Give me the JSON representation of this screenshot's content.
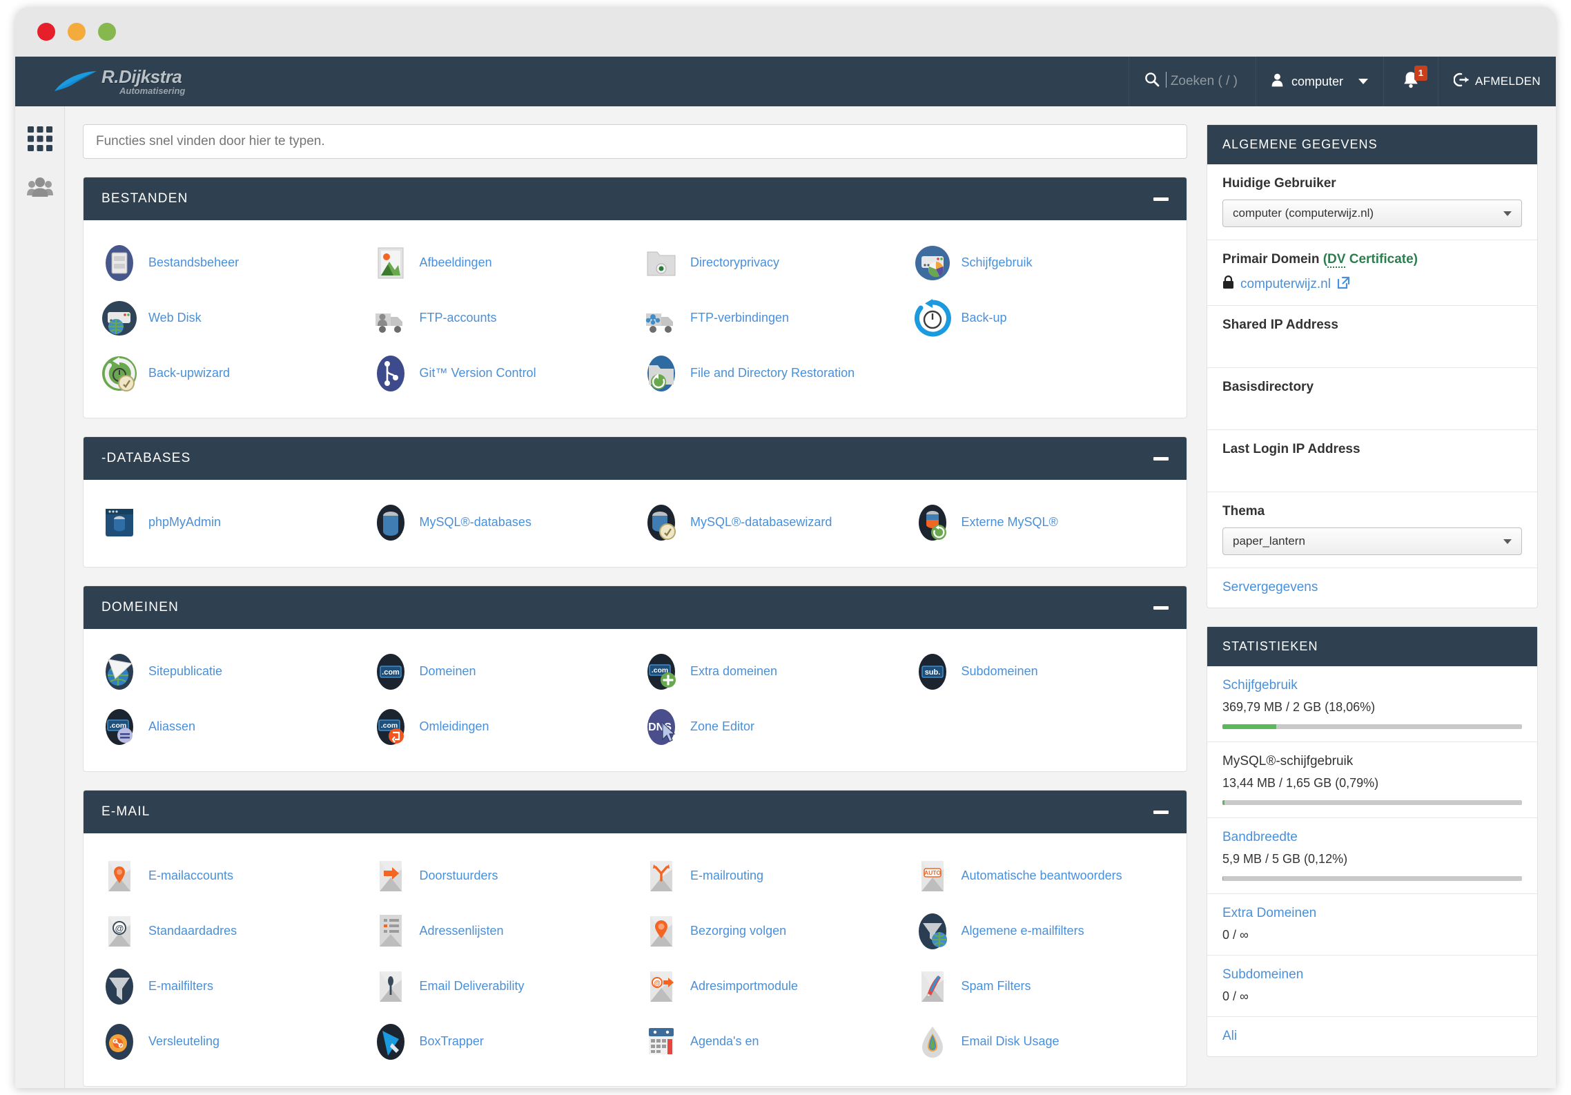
{
  "window": {
    "traffic_lights": [
      "close",
      "minimize",
      "maximize"
    ]
  },
  "brand": {
    "name": "R.Dijkstra",
    "tagline": "Automatisering",
    "logo_icon": "swoosh-logo"
  },
  "topnav": {
    "search_placeholder": "Zoeken ( / )",
    "search_icon": "search-icon",
    "user_label": "computer",
    "user_icon": "user-icon",
    "bell_icon": "bell-icon",
    "bell_badge": "1",
    "logout_label": "AFMELDEN",
    "logout_icon": "logout-icon"
  },
  "rail": {
    "items": [
      {
        "icon": "grid-apps-icon",
        "name": "apps",
        "active": true
      },
      {
        "icon": "users-group-icon",
        "name": "user-manager",
        "active": false
      }
    ]
  },
  "quicksearch": {
    "placeholder": "Functies snel vinden door hier te typen.",
    "value": ""
  },
  "sections": [
    {
      "title": "BESTANDEN",
      "collapse_icon": "minus-icon",
      "items": [
        {
          "label": "Bestandsbeheer",
          "icon": "file-manager-icon"
        },
        {
          "label": "Afbeeldingen",
          "icon": "images-icon"
        },
        {
          "label": "Directoryprivacy",
          "icon": "directory-privacy-icon"
        },
        {
          "label": "Schijfgebruik",
          "icon": "disk-usage-icon"
        },
        {
          "label": "Web Disk",
          "icon": "web-disk-icon"
        },
        {
          "label": "FTP-accounts",
          "icon": "ftp-accounts-icon"
        },
        {
          "label": "FTP-verbindingen",
          "icon": "ftp-connections-icon"
        },
        {
          "label": "Back-up",
          "icon": "backup-icon"
        },
        {
          "label": "Back-upwizard",
          "icon": "backup-wizard-icon"
        },
        {
          "label": "Git™ Version Control",
          "icon": "git-icon"
        },
        {
          "label": "File and Directory Restoration",
          "icon": "file-restore-icon"
        }
      ]
    },
    {
      "title": "-DATABASES",
      "collapse_icon": "minus-icon",
      "items": [
        {
          "label": "phpMyAdmin",
          "icon": "phpmyadmin-icon"
        },
        {
          "label": "MySQL®-databases",
          "icon": "mysql-databases-icon"
        },
        {
          "label": "MySQL®-databasewizard",
          "icon": "mysql-wizard-icon"
        },
        {
          "label": "Externe MySQL®",
          "icon": "remote-mysql-icon"
        }
      ]
    },
    {
      "title": "DOMEINEN",
      "collapse_icon": "minus-icon",
      "items": [
        {
          "label": "Sitepublicatie",
          "icon": "site-publisher-icon"
        },
        {
          "label": "Domeinen",
          "icon": "domains-icon"
        },
        {
          "label": "Extra domeinen",
          "icon": "addon-domains-icon"
        },
        {
          "label": "Subdomeinen",
          "icon": "subdomains-icon"
        },
        {
          "label": "Aliassen",
          "icon": "aliases-icon"
        },
        {
          "label": "Omleidingen",
          "icon": "redirects-icon"
        },
        {
          "label": "Zone Editor",
          "icon": "dns-zone-editor-icon"
        }
      ]
    },
    {
      "title": "E-MAIL",
      "collapse_icon": "minus-icon",
      "items": [
        {
          "label": "E-mailaccounts",
          "icon": "email-accounts-icon"
        },
        {
          "label": "Doorstuurders",
          "icon": "forwarders-icon"
        },
        {
          "label": "E-mailrouting",
          "icon": "email-routing-icon"
        },
        {
          "label": "Automatische beantwoorders",
          "icon": "autoresponders-icon"
        },
        {
          "label": "Standaardadres",
          "icon": "default-address-icon"
        },
        {
          "label": "Adressenlijsten",
          "icon": "mailing-lists-icon"
        },
        {
          "label": "Bezorging volgen",
          "icon": "track-delivery-icon"
        },
        {
          "label": "Algemene e-mailfilters",
          "icon": "global-email-filters-icon"
        },
        {
          "label": "E-mailfilters",
          "icon": "email-filters-icon"
        },
        {
          "label": "Email Deliverability",
          "icon": "email-deliverability-icon"
        },
        {
          "label": "Adresimportmodule",
          "icon": "address-importer-icon"
        },
        {
          "label": "Spam Filters",
          "icon": "spam-filters-icon"
        },
        {
          "label": "Versleuteling",
          "icon": "encryption-icon"
        },
        {
          "label": "BoxTrapper",
          "icon": "boxtrapper-icon"
        },
        {
          "label": "Agenda's en",
          "icon": "calendars-contacts-icon"
        },
        {
          "label": "Email Disk Usage",
          "icon": "email-disk-usage-icon"
        }
      ]
    }
  ],
  "sidebar": {
    "general": {
      "title": "ALGEMENE GEGEVENS",
      "current_user_label": "Huidige Gebruiker",
      "current_user_value": "computer (computerwijz.nl)",
      "primary_domain_label": "Primair Domein",
      "cert_abbr": "DV",
      "cert_rest": " Certificate)",
      "cert_open": "(",
      "domain_value": "computerwijz.nl",
      "lock_icon": "lock-icon",
      "external_icon": "external-link-icon",
      "shared_ip_label": "Shared IP Address",
      "shared_ip_value": "",
      "home_dir_label": "Basisdirectory",
      "home_dir_value": "",
      "last_login_label": "Last Login IP Address",
      "last_login_value": "",
      "theme_label": "Thema",
      "theme_value": "paper_lantern",
      "server_info_link": "Servergegevens"
    },
    "stats": {
      "title": "STATISTIEKEN",
      "items": [
        {
          "label": "Schijfgebruik",
          "value": "369,79 MB / 2 GB   (18,06%)",
          "percent": 18.06,
          "is_link": true,
          "has_bar": true
        },
        {
          "label": "MySQL®-schijfgebruik",
          "value": "13,44 MB / 1,65 GB   (0,79%)",
          "percent": 0.79,
          "is_link": false,
          "has_bar": true
        },
        {
          "label": "Bandbreedte",
          "value": "5,9 MB / 5 GB   (0,12%)",
          "percent": 0.12,
          "is_link": true,
          "has_bar": true
        },
        {
          "label": "Extra Domeinen",
          "value": "0 / ∞",
          "percent": 0,
          "is_link": true,
          "has_bar": false
        },
        {
          "label": "Subdomeinen",
          "value": "0 / ∞",
          "percent": 0,
          "is_link": true,
          "has_bar": false
        },
        {
          "label": "Ali",
          "value": "",
          "percent": 0,
          "is_link": true,
          "has_bar": false
        }
      ]
    }
  },
  "colors": {
    "navbar": "#2f4050",
    "link": "#4a90d9",
    "progress_green": "#5cb85c",
    "cert_green": "#2e7d4f",
    "badge": "#c9401c"
  }
}
